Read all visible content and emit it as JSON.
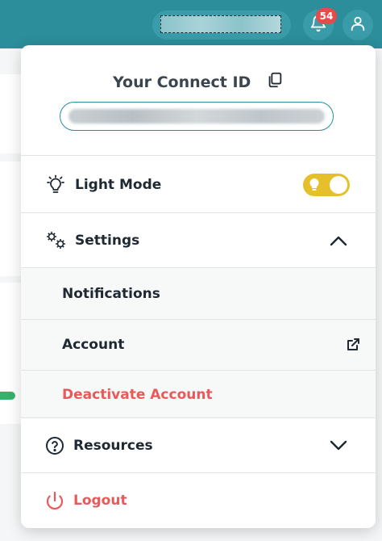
{
  "topbar": {
    "notification_count": "54",
    "bell_icon": "bell-icon",
    "user_icon": "user-icon"
  },
  "panel": {
    "connect_id_title": "Your Connect ID",
    "copy_icon": "copy-icon",
    "light_mode_label": "Light Mode",
    "light_mode_enabled": true,
    "settings_label": "Settings",
    "settings_expanded": true,
    "settings_items": [
      {
        "label": "Notifications"
      },
      {
        "label": "Account"
      },
      {
        "label": "Deactivate Account"
      }
    ],
    "resources_label": "Resources",
    "logout_label": "Logout"
  },
  "colors": {
    "brand_teal": "#2b8e9a",
    "toggle_yellow": "#e6c02a",
    "danger_red": "#e85a5a",
    "badge_red": "#e64b4b"
  }
}
